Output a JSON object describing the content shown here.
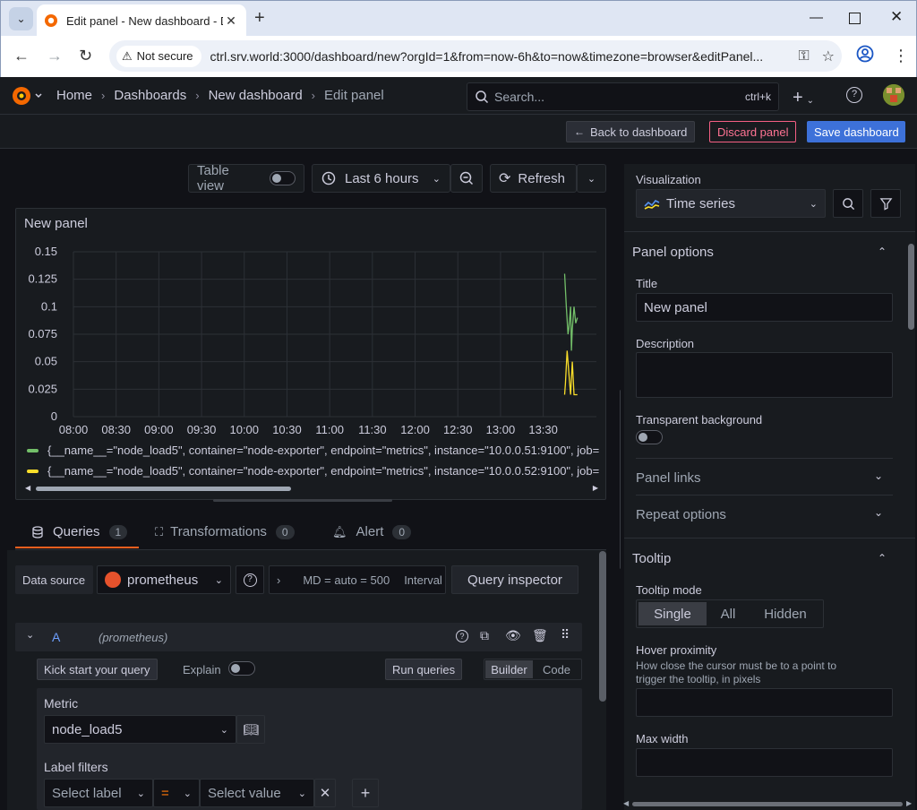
{
  "browser": {
    "tab_title": "Edit panel - New dashboard - D",
    "not_secure": "Not secure",
    "url": "ctrl.srv.world:3000/dashboard/new?orgId=1&from=now-6h&to=now&timezone=browser&editPanel..."
  },
  "topbar": {
    "breadcrumbs": [
      "Home",
      "Dashboards",
      "New dashboard",
      "Edit panel"
    ],
    "search_placeholder": "Search...",
    "search_shortcut": "ctrl+k"
  },
  "actions": {
    "back": "Back to dashboard",
    "discard": "Discard panel",
    "save": "Save dashboard"
  },
  "toolbar": {
    "table_view": "Table view",
    "time_range": "Last 6 hours",
    "refresh": "Refresh"
  },
  "panel": {
    "title": "New panel",
    "legend": [
      "{__name__=\"node_load5\", container=\"node-exporter\", endpoint=\"metrics\", instance=\"10.0.0.51:9100\", job=",
      "{__name__=\"node_load5\", container=\"node-exporter\", endpoint=\"metrics\", instance=\"10.0.0.52:9100\", job="
    ]
  },
  "chart_data": {
    "type": "line",
    "yticks": [
      "0",
      "0.025",
      "0.05",
      "0.075",
      "0.1",
      "0.125",
      "0.15"
    ],
    "ylim": [
      0,
      0.15
    ],
    "xticks": [
      "08:00",
      "08:30",
      "09:00",
      "09:30",
      "10:00",
      "10:30",
      "11:00",
      "11:30",
      "12:00",
      "12:30",
      "13:00",
      "13:30"
    ],
    "series": [
      {
        "color": "#73bf69",
        "points": [
          [
            13.75,
            0.13
          ],
          [
            13.77,
            0.1
          ],
          [
            13.79,
            0.075
          ],
          [
            13.8,
            0.08
          ],
          [
            13.82,
            0.1
          ],
          [
            13.83,
            0.06
          ],
          [
            13.84,
            0.08
          ],
          [
            13.86,
            0.1
          ],
          [
            13.88,
            0.085
          ],
          [
            13.9,
            0.09
          ]
        ]
      },
      {
        "color": "#fade2a",
        "points": [
          [
            13.75,
            0.02
          ],
          [
            13.76,
            0.03
          ],
          [
            13.78,
            0.06
          ],
          [
            13.8,
            0.04
          ],
          [
            13.82,
            0.02
          ],
          [
            13.84,
            0.05
          ],
          [
            13.86,
            0.02
          ],
          [
            13.9,
            0.02
          ]
        ]
      }
    ]
  },
  "query_tabs": [
    {
      "label": "Queries",
      "count": "1"
    },
    {
      "label": "Transformations",
      "count": "0"
    },
    {
      "label": "Alert",
      "count": "0"
    }
  ],
  "query": {
    "data_source_label": "Data source",
    "data_source": "prometheus",
    "options_summary": "MD = auto = 500",
    "interval_label": "Interval",
    "inspector": "Query inspector",
    "ref_id": "A",
    "ref_ds": "(prometheus)",
    "kick_start": "Kick start your query",
    "explain": "Explain",
    "run": "Run queries",
    "builder": "Builder",
    "code": "Code",
    "metric_label": "Metric",
    "metric_value": "node_load5",
    "label_filters": "Label filters",
    "select_label": "Select label",
    "operator": "=",
    "select_value": "Select value"
  },
  "options": {
    "visualization_label": "Visualization",
    "visualization": "Time series",
    "panel_options": "Panel options",
    "title_label": "Title",
    "title_value": "New panel",
    "description_label": "Description",
    "transparent_label": "Transparent background",
    "panel_links": "Panel links",
    "repeat_options": "Repeat options",
    "tooltip": "Tooltip",
    "tooltip_mode_label": "Tooltip mode",
    "tooltip_modes": [
      "Single",
      "All",
      "Hidden"
    ],
    "hover_label": "Hover proximity",
    "hover_desc_1": "How close the cursor must be to a point to",
    "hover_desc_2": "trigger the tooltip, in pixels",
    "max_width": "Max width"
  }
}
